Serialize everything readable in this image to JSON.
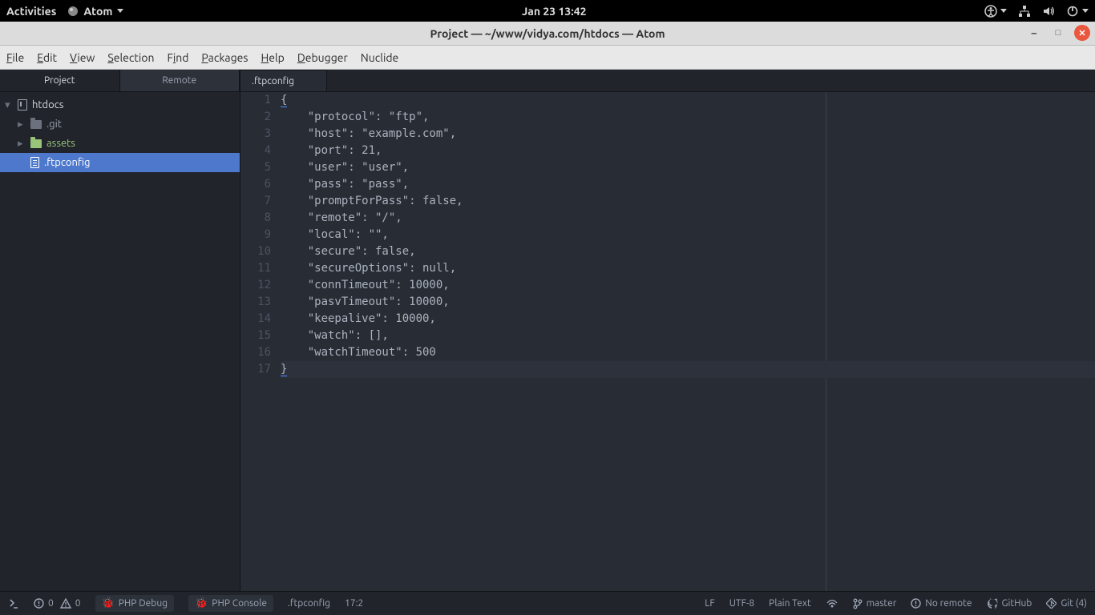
{
  "os_topbar": {
    "activities": "Activities",
    "app_name": "Atom",
    "datetime": "Jan 23  13:42"
  },
  "window": {
    "title": "Project — ~/www/vidya.com/htdocs — Atom"
  },
  "menubar": [
    "File",
    "Edit",
    "View",
    "Selection",
    "Find",
    "Packages",
    "Help",
    "Debugger",
    "Nuclide"
  ],
  "sidebar": {
    "tabs": [
      "Project",
      "Remote"
    ],
    "tree": {
      "root": "htdocs",
      "items": [
        ".git",
        "assets",
        ".ftpconfig"
      ]
    }
  },
  "editor": {
    "tab": ".ftpconfig",
    "lines": [
      "{",
      "    \"protocol\": \"ftp\",",
      "    \"host\": \"example.com\",",
      "    \"port\": 21,",
      "    \"user\": \"user\",",
      "    \"pass\": \"pass\",",
      "    \"promptForPass\": false,",
      "    \"remote\": \"/\",",
      "    \"local\": \"\",",
      "    \"secure\": false,",
      "    \"secureOptions\": null,",
      "    \"connTimeout\": 10000,",
      "    \"pasvTimeout\": 10000,",
      "    \"keepalive\": 10000,",
      "    \"watch\": [],",
      "    \"watchTimeout\": 500",
      "}"
    ]
  },
  "statusbar": {
    "err_count": "0",
    "warn_count": "0",
    "php_debug": "PHP Debug",
    "php_console": "PHP Console",
    "file": ".ftpconfig",
    "cursor": "17:2",
    "line_ending": "LF",
    "encoding": "UTF-8",
    "grammar": "Plain Text",
    "branch": "master",
    "remote": "No remote",
    "github": "GitHub",
    "git": "Git (4)"
  }
}
